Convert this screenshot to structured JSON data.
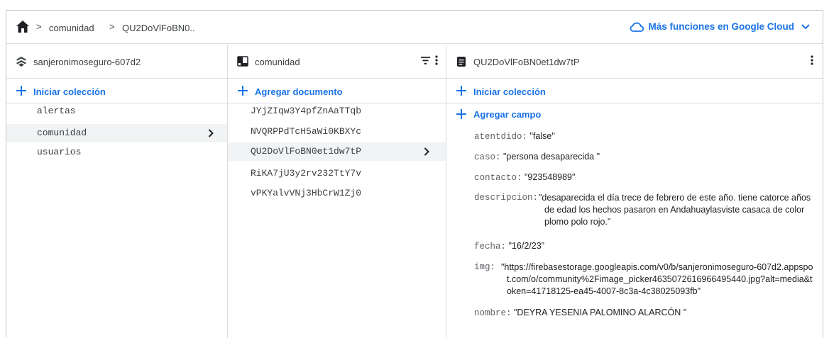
{
  "breadcrumb": {
    "items": [
      "comunidad",
      "QU2DoVlFoBN0.."
    ],
    "separator": ">"
  },
  "cloud_link": {
    "label": "Más funciones en Google Cloud"
  },
  "columns": {
    "project": {
      "title": "sanjeronimoseguro-607d2",
      "action": "Iniciar colección",
      "items": [
        "alertas",
        "comunidad",
        "usuarios"
      ],
      "selected": "comunidad"
    },
    "collection": {
      "title": "comunidad",
      "action": "Agregar documento",
      "items": [
        "JYjZIqw3Y4pfZnAaTTqb",
        "NVQRPPdTcH5aWi0KBXYc",
        "QU2DoVlFoBN0et1dw7tP",
        "RiKA7jU3y2rv232TtY7v",
        "vPKYalvVNj3HbCrW1Zj0"
      ],
      "selected": "QU2DoVlFoBN0et1dw7tP"
    },
    "document": {
      "title": "QU2DoVlFoBN0et1dw7tP",
      "action": "Iniciar colección",
      "add_field": "Agregar campo",
      "fields": {
        "atentdido": {
          "key": "atentdido:",
          "value": "\"false\""
        },
        "caso": {
          "key": "caso:",
          "value": "\"persona desaparecida \""
        },
        "contacto": {
          "key": "contacto:",
          "value": "\"923548989\""
        },
        "descripcion": {
          "key": "descripcion:",
          "value": "\"desaparecida el día trece de febrero de este año. tiene catorce años de edad los hechos pasaron en Andahuaylasviste casaca de color plomo polo rojo.\""
        },
        "fecha": {
          "key": "fecha:",
          "value": "\"16/2/23\""
        },
        "img": {
          "key": "img:",
          "value": "\"https://firebasestorage.googleapis.com/v0/b/sanjeronimoseguro-607d2.appspot.com/o/community%2Fimage_picker4635072616966495440.jpg?alt=media&token=41718125-ea45-4007-8c3a-4c38025093fb\""
        },
        "nombre": {
          "key": "nombre:",
          "value": "\"DEYRA YESENIA PALOMINO ALARCÓN \""
        }
      }
    }
  },
  "colors": {
    "accent": "#1a73e8",
    "selected_bg": "#f1f3f4",
    "divider": "#dadce0"
  }
}
